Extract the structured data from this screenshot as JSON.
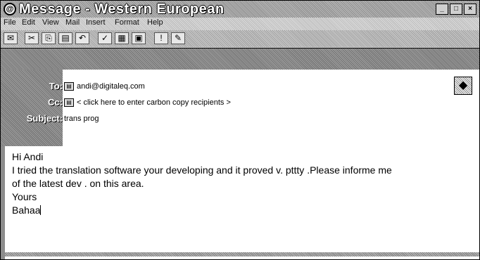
{
  "window": {
    "title": "Message - Western European"
  },
  "menu": [
    "File",
    "Edit",
    "View",
    "Mail",
    "Insert",
    "Format",
    "Help"
  ],
  "headers": {
    "to_label": "To:",
    "to_value": "andi@digitaleq.com",
    "cc_label": "Cc:",
    "cc_value": "< click here to enter carbon copy recipients >",
    "subject_label": "Subject:",
    "subject_value": "trans prog"
  },
  "body": {
    "lines": [
      "Hi Andi",
      "I tried the translation software your developing and it proved v. pttty .Please informe me",
      "of the latest dev . on this area.",
      "Yours",
      "Bahaa"
    ]
  },
  "icons": {
    "app": "envelope-icon",
    "window_buttons": [
      "minimize-icon",
      "maximize-icon",
      "close-icon"
    ],
    "toolbar": [
      "send-icon",
      "cut-icon",
      "copy-icon",
      "paste-icon",
      "undo-icon",
      "check-names-icon",
      "address-book-icon",
      "insert-file-icon",
      "priority-icon",
      "signature-icon"
    ],
    "security": "security-icon"
  }
}
